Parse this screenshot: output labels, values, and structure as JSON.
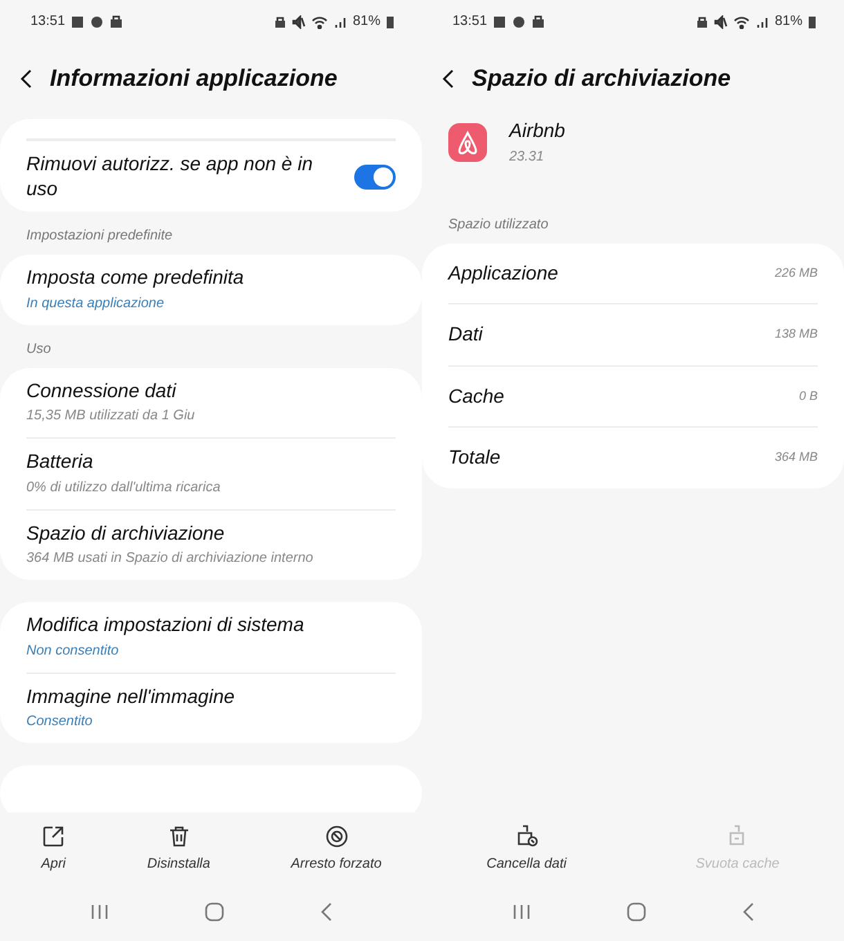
{
  "screens": [
    {
      "kind": "app_info",
      "status_bar": {
        "time": "13:51",
        "battery": "81%"
      },
      "title": "Informazioni applicazione",
      "sections": [
        {
          "top_cut": true,
          "items": [
            {
              "kind": "toggle",
              "title": "Rimuovi autorizz. se app non è in uso",
              "on": true
            }
          ]
        },
        {
          "header": "Impostazioni predefinite",
          "items": [
            {
              "kind": "detail",
              "title": "Imposta come predefinita",
              "subtitle": "In questa applicazione",
              "accent": true
            }
          ]
        },
        {
          "header": "Uso",
          "items": [
            {
              "kind": "detail",
              "title": "Connessione dati",
              "subtitle": "15,35 MB utilizzati da 1 Giu",
              "accent": false
            },
            {
              "kind": "detail",
              "title": "Batteria",
              "subtitle": "0% di utilizzo dall'ultima ricarica",
              "accent": false
            },
            {
              "kind": "detail",
              "title": "Spazio di archiviazione",
              "subtitle": "364 MB usati in Spazio di archiviazione interno",
              "accent": false
            }
          ]
        },
        {
          "items": [
            {
              "kind": "detail",
              "title": "Modifica impostazioni di sistema",
              "subtitle": "Non consentito",
              "accent": true
            },
            {
              "kind": "detail",
              "title": "Immagine nell'immagine",
              "subtitle": "Consentito",
              "accent": true
            }
          ]
        },
        {
          "peek": true
        }
      ],
      "actions": [
        {
          "kind": "open",
          "label": "Apri",
          "disabled": false
        },
        {
          "kind": "uninstall",
          "label": "Disinstalla",
          "disabled": false
        },
        {
          "kind": "force_stop",
          "label": "Arresto forzato",
          "disabled": false
        }
      ]
    },
    {
      "kind": "storage",
      "status_bar": {
        "time": "13:51",
        "battery": "81%"
      },
      "title": "Spazio di archiviazione",
      "app": {
        "name": "Airbnb",
        "version": "23.31"
      },
      "sections": [
        {
          "header": "Spazio utilizzato",
          "items": [
            {
              "kind": "value",
              "title": "Applicazione",
              "value": "226 MB"
            },
            {
              "kind": "value",
              "title": "Dati",
              "value": "138 MB"
            },
            {
              "kind": "value",
              "title": "Cache",
              "value": "0 B"
            },
            {
              "kind": "value",
              "title": "Totale",
              "value": "364 MB"
            }
          ]
        }
      ],
      "actions": [
        {
          "kind": "clear_data",
          "label": "Cancella dati",
          "disabled": false
        },
        {
          "kind": "clear_cache",
          "label": "Svuota cache",
          "disabled": true
        }
      ]
    }
  ]
}
